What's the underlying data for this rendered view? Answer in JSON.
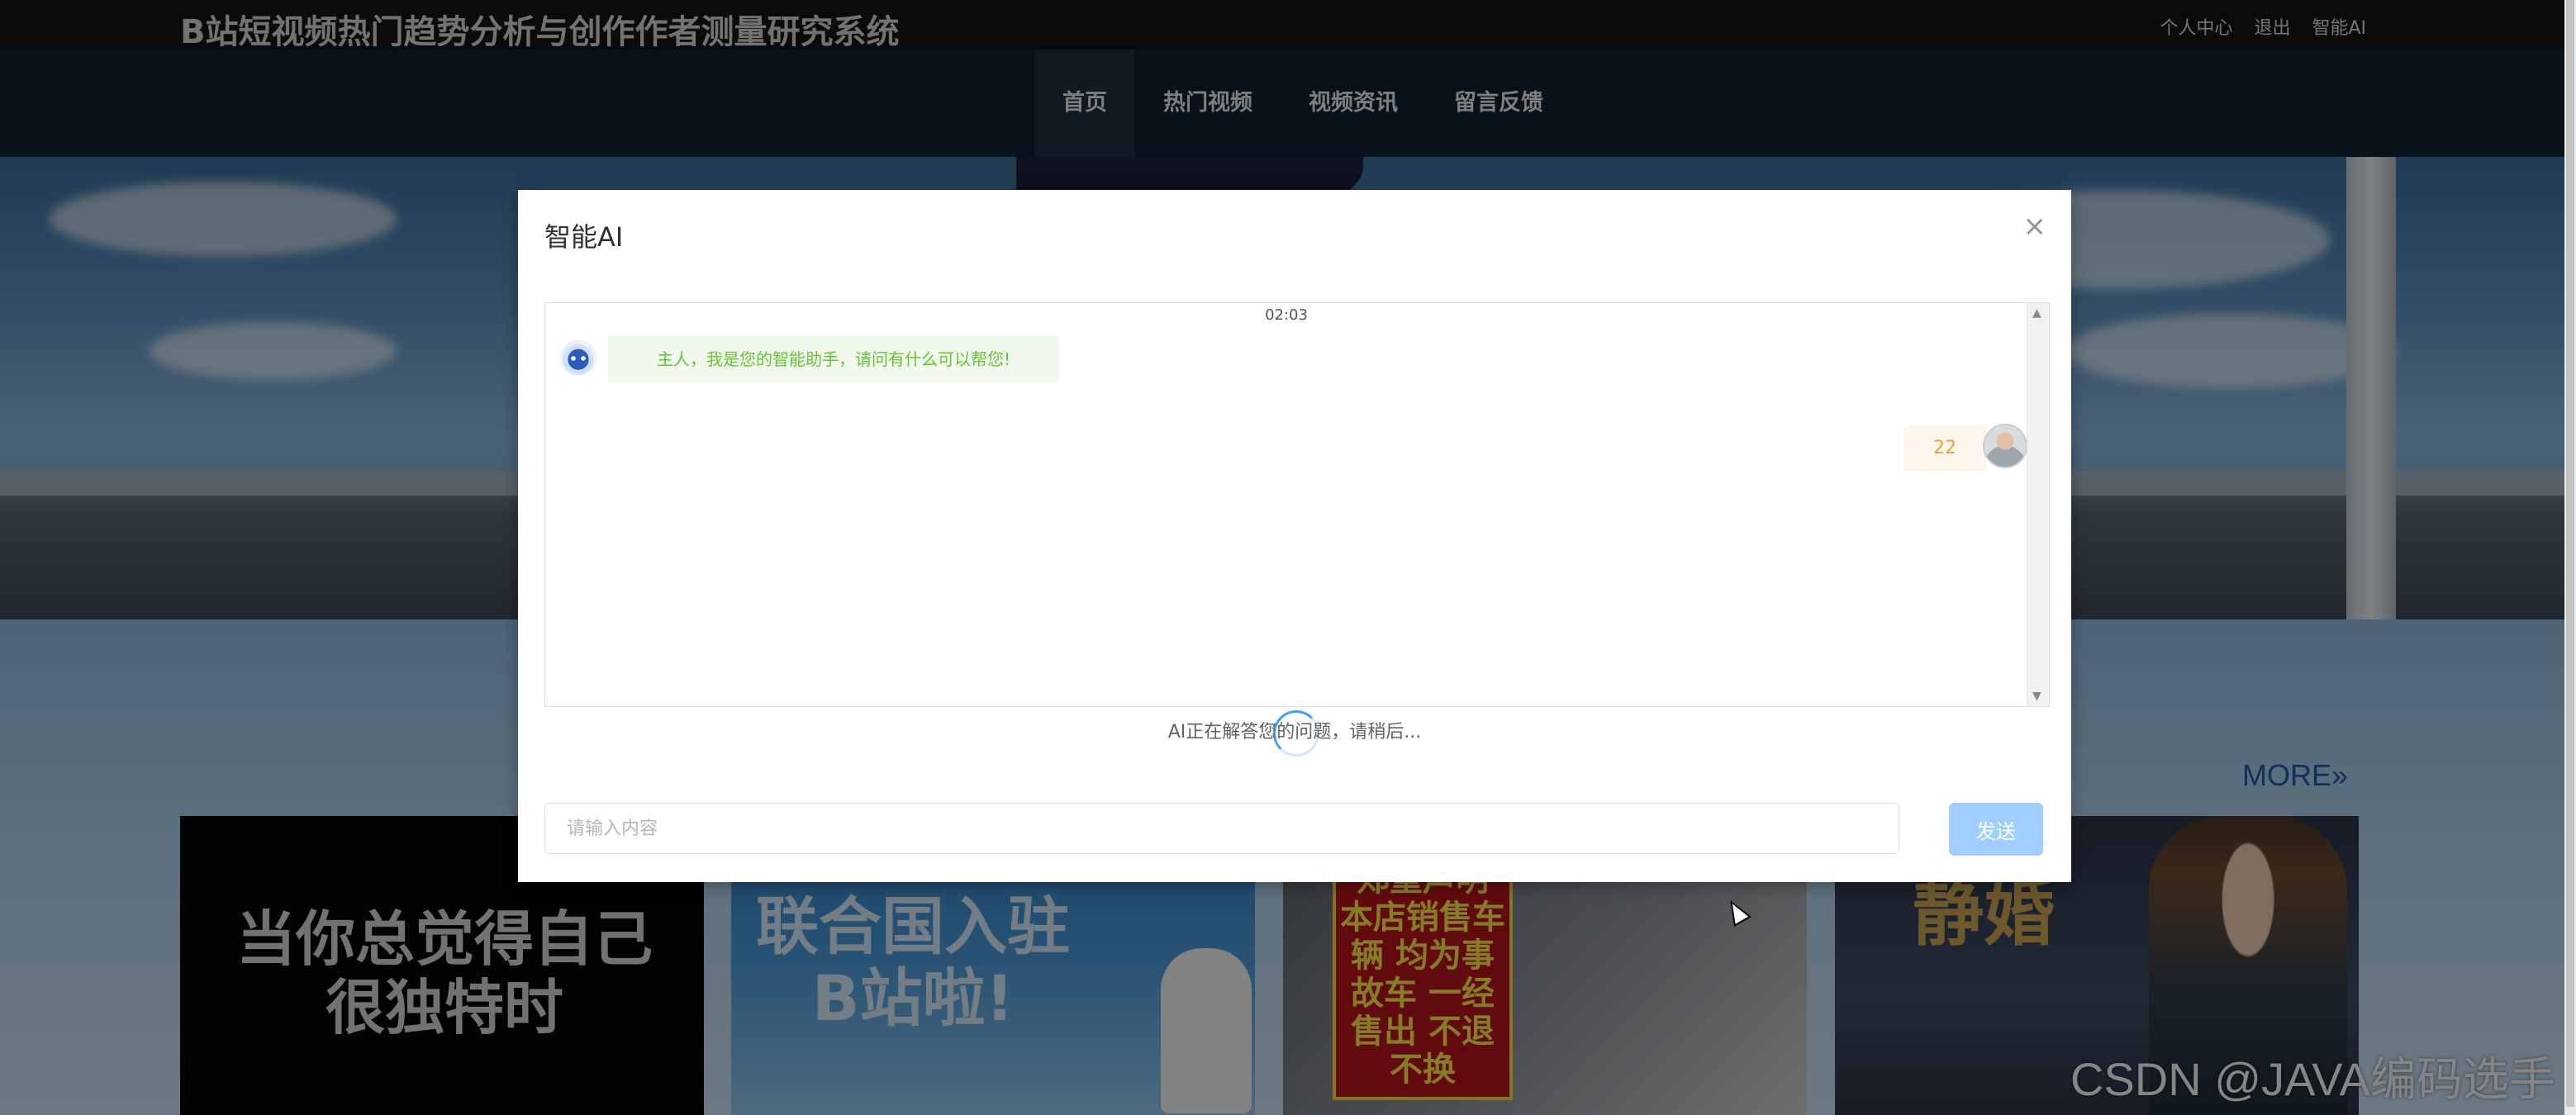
{
  "header": {
    "site_title": "B站短视频热门趋势分析与创作作者测量研究系统",
    "top_links": [
      "个人中心",
      "退出",
      "智能AI"
    ]
  },
  "nav": {
    "items": [
      "首页",
      "热门视频",
      "视频资讯",
      "留言反馈"
    ],
    "active": "首页"
  },
  "section": {
    "more_label": "MORE»"
  },
  "tiles": [
    {
      "text": "当你总觉得自己很独特时"
    },
    {
      "text": "联合国入驻B站啦!"
    },
    {
      "text": "郑重声明 本店销售车辆 均为事故车 一经售出 不退不换"
    },
    {
      "text": "静婚"
    }
  ],
  "modal": {
    "title": "智能AI",
    "close_icon": "×",
    "timestamp": "02:03",
    "ai_message": "主人，我是您的智能助手，请问有什么可以帮您!",
    "user_message": "22",
    "loading_text": "AI正在解答您的问题，请稍后...",
    "input_placeholder": "请输入内容",
    "send_label": "发送",
    "colors": {
      "ai_bubble_bg": "#f0f9eb",
      "ai_bubble_text": "#67c23a",
      "user_bubble_bg": "#fdf6ec",
      "user_bubble_text": "#e6a23c",
      "send_button": "#a0cfff"
    }
  },
  "watermark": "CSDN @JAVA编码选手"
}
